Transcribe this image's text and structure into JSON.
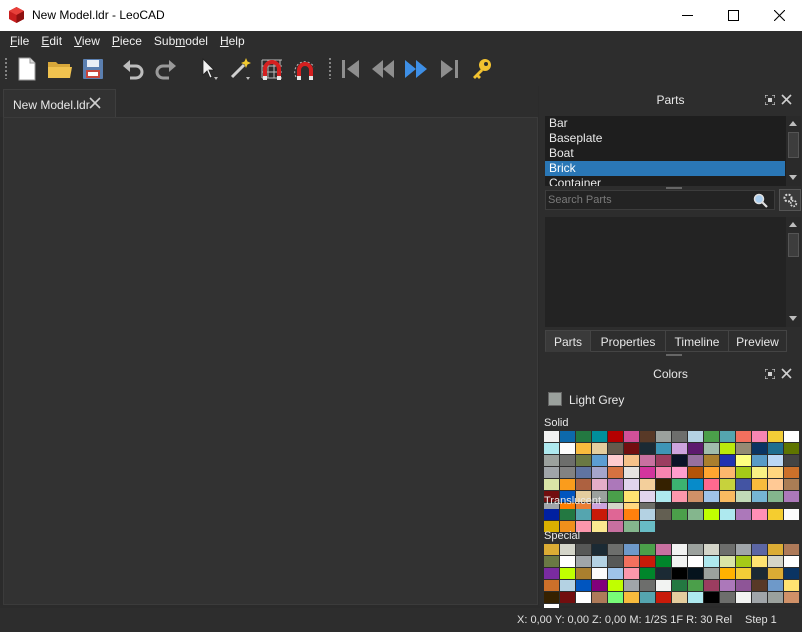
{
  "window": {
    "title": "New Model.ldr - LeoCAD",
    "minimize_icon": "minimize-icon",
    "maximize_icon": "maximize-icon",
    "close_icon": "close-icon"
  },
  "menu": [
    {
      "pre": "",
      "ul": "F",
      "post": "ile"
    },
    {
      "pre": "",
      "ul": "E",
      "post": "dit"
    },
    {
      "pre": "",
      "ul": "V",
      "post": "iew"
    },
    {
      "pre": "",
      "ul": "P",
      "post": "iece"
    },
    {
      "pre": "Sub",
      "ul": "m",
      "post": "odel"
    },
    {
      "pre": "",
      "ul": "H",
      "post": "elp"
    }
  ],
  "toolbar": {
    "icons": [
      "new-file-icon",
      "open-folder-icon",
      "save-icon",
      "undo-icon",
      "redo-icon",
      "select-arrow-icon",
      "magic-wand-icon",
      "snap-grid-icon",
      "snap-angle-icon",
      "first-step-icon",
      "previous-step-icon",
      "next-step-icon",
      "last-step-icon",
      "key-icon"
    ]
  },
  "document_tab": {
    "label": "New Model.ldr"
  },
  "parts_panel": {
    "title": "Parts",
    "categories": [
      "Bar",
      "Baseplate",
      "Boat",
      "Brick",
      "Container"
    ],
    "selected_index": 3,
    "search_placeholder": "Search Parts"
  },
  "dock_tabs": [
    "Parts",
    "Properties",
    "Timeline",
    "Preview"
  ],
  "active_dock_tab": 0,
  "colors_panel": {
    "title": "Colors",
    "current_color": "Light Grey",
    "current_color_hex": "#9ba19d",
    "groups": [
      {
        "label": "Solid",
        "colors": [
          "#f2f3f2",
          "#0d69ab",
          "#237841",
          "#008f9b",
          "#b40000",
          "#d05098",
          "#583927",
          "#9ba19d",
          "#6d6e6c",
          "#b4d2e3",
          "#4b9f4a",
          "#55a5af",
          "#f2705e",
          "#f785b1",
          "#f2cd37",
          "#ffffff",
          "#aee9ef",
          "#fcfcfc",
          "#f8bb3d",
          "#e4cd9e",
          "#645a4c",
          "#720e0f",
          "#1b2a34",
          "#3e95b6",
          "#cda4de",
          "#5d1a6e",
          "#a0bcac",
          "#bbe90b",
          "#958a73",
          "#0a3463",
          "#1f6e8f",
          "#5f7500",
          "#9ba19d",
          "#6d6e6c",
          "#6a7944",
          "#5c9dd1",
          "#fecccf",
          "#f5c189",
          "#c870a0",
          "#9b3d60",
          "#0a1327",
          "#96709f",
          "#aa7f2e",
          "#2032b0",
          "#ffff80",
          "#589bc7",
          "#bbd7f4",
          "#444444",
          "#a0a5a9",
          "#828282",
          "#6074a1",
          "#a5a5cb",
          "#d67240",
          "#e6e3e0",
          "#d3359d",
          "#f785b1",
          "#ff9ecd",
          "#b35408",
          "#ffa531",
          "#fcb76d",
          "#a5ca18",
          "#f8f184",
          "#ffd67f",
          "#cc702a",
          "#d9e4a7",
          "#fa9c1c",
          "#ad6140",
          "#e4adc8",
          "#ac78ba",
          "#e1d5ed",
          "#f3cf9b",
          "#352100",
          "#3cb371",
          "#078bc9",
          "#ff698f",
          "#c7d23c",
          "#4354a3",
          "#f8bb3d",
          "#ffc995",
          "#aa7d55",
          "#720e0f",
          "#0055bf",
          "#e4cd9e",
          "#9ba19d",
          "#4a9f4a",
          "#ffe371",
          "#e1d5ed",
          "#aee9ef",
          "#fc97ac",
          "#d09168",
          "#9fc3e9",
          "#f9ba61",
          "#c2dab8",
          "#75b5d4",
          "#84b68d",
          "#ac78ba",
          "#a0a5a9",
          "#ff7f00",
          "#eb7f34",
          "#cda4de",
          "#d4d5c9",
          "#ffd67f",
          "#6c6e68"
        ]
      },
      {
        "label": "Translucent",
        "colors": [
          "#0020a0",
          "#237841",
          "#55a5af",
          "#c91a09",
          "#df6695",
          "#ff800d",
          "#b4d2e3",
          "#635f52",
          "#4b9f4a",
          "#84b68d",
          "#c0ff00",
          "#aee9ef",
          "#ac78ba",
          "#ff8fb6",
          "#f5cd2f",
          "#fcfcfc",
          "#dab000",
          "#f08f1c",
          "#fc97ac",
          "#fbe890",
          "#c870a0",
          "#84b68d",
          "#68bcc5"
        ]
      },
      {
        "label": "Special",
        "colors": [
          "#dbac34",
          "#d4d5c9",
          "#575857",
          "#1b2a34",
          "#6d6e6c",
          "#6e99c9",
          "#4b9f4a",
          "#c870a0",
          "#f2f3f2",
          "#9ba19d",
          "#d4d5c9",
          "#6d6e6c",
          "#a0a5a9",
          "#5c66a4",
          "#dbac34",
          "#ae7a59",
          "#6a7944",
          "#ffffff",
          "#a0a5a9",
          "#b4d2e3",
          "#575857",
          "#f2705e",
          "#c91a09",
          "#00852b",
          "#f2f3f2",
          "#ffffff",
          "#aee9ef",
          "#d9e4a7",
          "#a5ca18",
          "#ffe371",
          "#d4d5c9",
          "#ffffff",
          "#7a2ba0",
          "#c0ff00",
          "#aa7f2e",
          "#fcfcfc",
          "#9fc3e9",
          "#fc97ac",
          "#00852b",
          "#1b2a34",
          "#000000",
          "#05131d",
          "#9ba19d",
          "#ffb300",
          "#f2cd37",
          "#1b2a34",
          "#dbac34",
          "#0a3463",
          "#cc702a",
          "#b4d2e3",
          "#0055bf",
          "#81007b",
          "#c0ff00",
          "#a0a5a9",
          "#6d6e6c",
          "#f2f3f2",
          "#237841",
          "#4b9f4a",
          "#9b3d60",
          "#ac78ba",
          "#8e5597",
          "#583927",
          "#6e99c9",
          "#ffe371",
          "#352100",
          "#720e0f",
          "#ffffff",
          "#ae7a59",
          "#78fc78",
          "#f8bb3d",
          "#55a5af",
          "#c91a09",
          "#e4cd9e",
          "#aee9ef",
          "#000000",
          "#6d6e6c",
          "#f2f3f2",
          "#a0a5a9",
          "#9ba19d",
          "#d09168",
          "#ffffff"
        ]
      }
    ]
  },
  "status": {
    "coords": "X: 0,00 Y: 0,00 Z: 0,00   M: 1/2S 1F R: 30 Rel",
    "step": "Step 1"
  }
}
